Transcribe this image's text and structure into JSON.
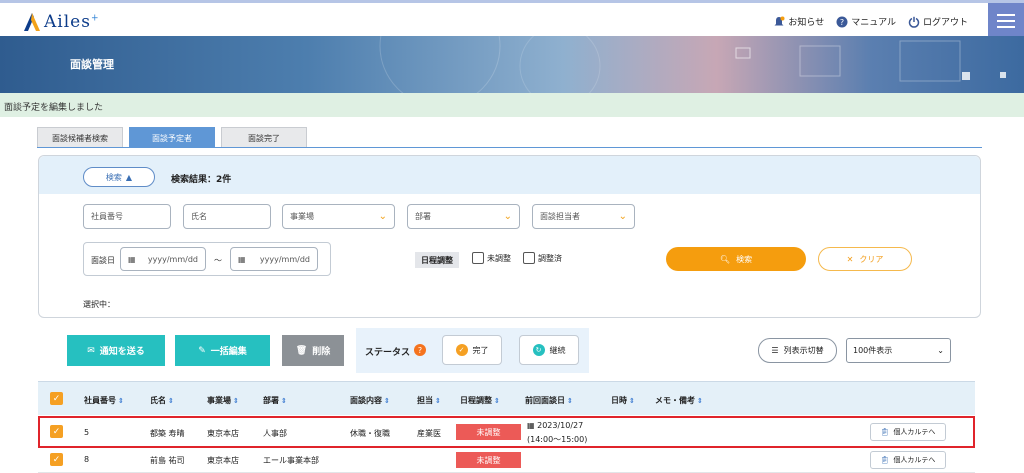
{
  "header": {
    "logo_text": "Ailes",
    "logo_sup": "+",
    "links": {
      "notice": "お知らせ",
      "manual": "マニュアル",
      "logout": "ログアウト"
    }
  },
  "banner": {
    "title": "面談管理"
  },
  "notice": {
    "text": "面談予定を編集しました"
  },
  "tabs": [
    {
      "label": "面談候補者検索"
    },
    {
      "label": "面談予定者"
    },
    {
      "label": "面談完了"
    }
  ],
  "search": {
    "toggle_label": "検索",
    "result_label": "検索結果：2件",
    "employee_no_placeholder": "社員番号",
    "name_placeholder": "氏名",
    "site_select": "事業場",
    "dept_select": "部署",
    "staff_select": "面談担当者",
    "date_label": "面談日",
    "date_from_placeholder": "yyyy/mm/dd",
    "date_sep": "〜",
    "date_to_placeholder": "yyyy/mm/dd",
    "schedule_tag": "日程調整",
    "unadjusted": "未調整",
    "adjusted": "調整済",
    "search_button": "検索",
    "clear_button": "クリア",
    "selected_label": "選択中："
  },
  "actions": {
    "notify": "通知を送る",
    "bulk_edit": "一括編集",
    "delete": "削除",
    "status_label": "ステータス",
    "complete": "完了",
    "continue": "継続",
    "columns": "列表示切替",
    "page_size": "100件表示"
  },
  "table": {
    "headers": [
      "社員番号",
      "氏名",
      "事業場",
      "部署",
      "面談内容",
      "担当",
      "日程調整",
      "前回面談日",
      "日時",
      "メモ・備考"
    ],
    "rows": [
      {
        "id": "5",
        "name": "都築 寿晴",
        "site": "東京本店",
        "dept": "人事部",
        "content": "休職・復職",
        "staff": "産業医",
        "schedule": "未調整",
        "last_date": "2023/10/27",
        "last_time": "(14:00〜15:00)",
        "karte": "個人カルテへ"
      },
      {
        "id": "8",
        "name": "前島 祐司",
        "site": "東京本店",
        "dept": "エール事業本部",
        "content": "",
        "staff": "",
        "schedule": "未調整",
        "last_date": "",
        "last_time": "",
        "karte": "個人カルテへ"
      }
    ]
  },
  "colors": {
    "accent": "#f59d0e",
    "teal": "#26c0c0",
    "gray": "#8c9196",
    "red": "#ec5a57",
    "tab_active": "#5f97d6"
  }
}
